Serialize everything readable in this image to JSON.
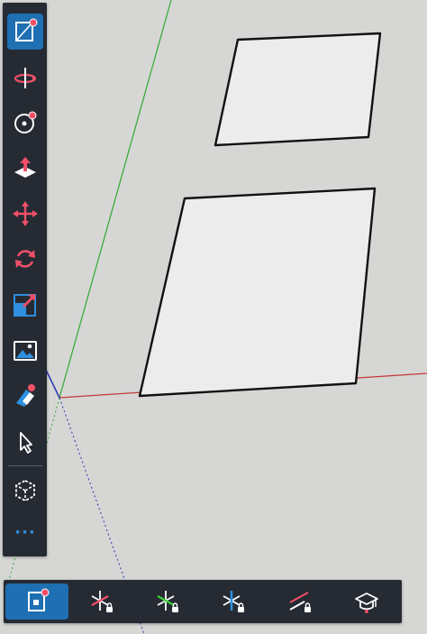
{
  "app": {
    "viewport_background": "#d6d6d4"
  },
  "axes": {
    "red_axis_color": "#c23a3a",
    "green_axis_color": "#2faa2f",
    "blue_axis_color": "#2a36b8"
  },
  "left_toolbar": {
    "background": "#262b33",
    "active_color": "#1f6fb3",
    "accent_color": "#f05068",
    "tools": [
      {
        "id": "rectangle",
        "icon": "rectangle-tool-icon",
        "active": true
      },
      {
        "id": "orbit",
        "icon": "orbit-icon",
        "active": false
      },
      {
        "id": "circle",
        "icon": "circle-tool-icon",
        "active": false
      },
      {
        "id": "push-pull",
        "icon": "push-pull-icon",
        "active": false
      },
      {
        "id": "move",
        "icon": "move-icon",
        "active": false
      },
      {
        "id": "rotate",
        "icon": "rotate-icon",
        "active": false
      },
      {
        "id": "scale",
        "icon": "scale-icon",
        "active": false
      },
      {
        "id": "image",
        "icon": "image-icon",
        "active": false
      },
      {
        "id": "paint",
        "icon": "paint-bucket-icon",
        "active": false
      },
      {
        "id": "select",
        "icon": "select-arrow-icon",
        "active": false
      },
      {
        "id": "components",
        "icon": "component-cube-icon",
        "active": false
      }
    ],
    "more_label": "···"
  },
  "bottom_toolbar": {
    "tools": [
      {
        "id": "draw-on-face",
        "icon": "rectangle-on-face-icon",
        "active": true
      },
      {
        "id": "lock-red",
        "icon": "axis-lock-red-icon",
        "active": false
      },
      {
        "id": "lock-green",
        "icon": "axis-lock-green-icon",
        "active": false
      },
      {
        "id": "lock-blue",
        "icon": "axis-lock-blue-icon",
        "active": false
      },
      {
        "id": "lock-line",
        "icon": "line-lock-icon",
        "active": false
      },
      {
        "id": "learn",
        "icon": "graduation-cap-icon",
        "active": false
      }
    ]
  }
}
